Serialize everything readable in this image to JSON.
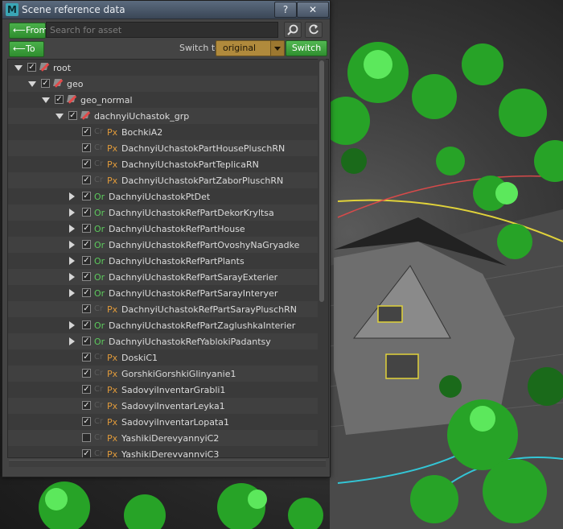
{
  "window": {
    "title": "Scene reference data",
    "app_icon_letter": "M",
    "help_label": "?",
    "close_label": "✕"
  },
  "toolbar": {
    "from_label": "From",
    "to_label": "To",
    "arrow_glyph": "⟵",
    "search_placeholder": "Search for asset",
    "search_value": "",
    "switch_to_label": "Switch to",
    "version_value": "original",
    "switch_button_label": "Switch",
    "icons": {
      "search": "search-icon",
      "refresh": "refresh-icon"
    }
  },
  "tree": {
    "rows": [
      {
        "label": "root",
        "depth": 0,
        "expander": "open",
        "checked": true,
        "badge": "ref"
      },
      {
        "label": "geo",
        "depth": 1,
        "expander": "open",
        "checked": true,
        "badge": "ref"
      },
      {
        "label": "geo_normal",
        "depth": 2,
        "expander": "open",
        "checked": true,
        "badge": "ref"
      },
      {
        "label": "dachnyiUchastok_grp",
        "depth": 3,
        "expander": "open",
        "checked": true,
        "badge": "ref"
      },
      {
        "label": "BochkiA2",
        "depth": 4,
        "expander": "none",
        "checked": true,
        "badge": "Px",
        "ghost": "Cr"
      },
      {
        "label": "DachnyiUchastokPartHousePluschRN",
        "depth": 4,
        "expander": "none",
        "checked": true,
        "badge": "Px",
        "ghost": "Cr"
      },
      {
        "label": "DachnyiUchastokPartTeplicaRN",
        "depth": 4,
        "expander": "none",
        "checked": true,
        "badge": "Px",
        "ghost": "Cr"
      },
      {
        "label": "DachnyiUchastokPartZaborPluschRN",
        "depth": 4,
        "expander": "none",
        "checked": true,
        "badge": "Px",
        "ghost": "Cr"
      },
      {
        "label": "DachnyiUchastokPtDet",
        "depth": 4,
        "expander": "closed",
        "checked": true,
        "badge": "Or"
      },
      {
        "label": "DachnyiUchastokRefPartDekorKryltsa",
        "depth": 4,
        "expander": "closed",
        "checked": true,
        "badge": "Or"
      },
      {
        "label": "DachnyiUchastokRefPartHouse",
        "depth": 4,
        "expander": "closed",
        "checked": true,
        "badge": "Or"
      },
      {
        "label": "DachnyiUchastokRefPartOvoshyNaGryadke",
        "depth": 4,
        "expander": "closed",
        "checked": true,
        "badge": "Or"
      },
      {
        "label": "DachnyiUchastokRefPartPlants",
        "depth": 4,
        "expander": "closed",
        "checked": true,
        "badge": "Or"
      },
      {
        "label": "DachnyiUchastokRefPartSarayExterier",
        "depth": 4,
        "expander": "closed",
        "checked": true,
        "badge": "Or"
      },
      {
        "label": "DachnyiUchastokRefPartSarayInteryer",
        "depth": 4,
        "expander": "closed",
        "checked": true,
        "badge": "Or"
      },
      {
        "label": "DachnyiUchastokRefPartSarayPluschRN",
        "depth": 4,
        "expander": "none",
        "checked": true,
        "badge": "Px",
        "ghost": "Cr"
      },
      {
        "label": "DachnyiUchastokRefPartZaglushkaInterier",
        "depth": 4,
        "expander": "closed",
        "checked": true,
        "badge": "Or"
      },
      {
        "label": "DachnyiUchastokRefYablokiPadantsy",
        "depth": 4,
        "expander": "closed",
        "checked": true,
        "badge": "Or"
      },
      {
        "label": "DoskiC1",
        "depth": 4,
        "expander": "none",
        "checked": true,
        "badge": "Px",
        "ghost": "Cr"
      },
      {
        "label": "GorshkiGorshkiGlinyanie1",
        "depth": 4,
        "expander": "none",
        "checked": true,
        "badge": "Px",
        "ghost": "Cr"
      },
      {
        "label": "SadovyiInventarGrabli1",
        "depth": 4,
        "expander": "none",
        "checked": true,
        "badge": "Px",
        "ghost": "Cr"
      },
      {
        "label": "SadovyiInventarLeyka1",
        "depth": 4,
        "expander": "none",
        "checked": true,
        "badge": "Px",
        "ghost": "Cr"
      },
      {
        "label": "SadovyiInventarLopata1",
        "depth": 4,
        "expander": "none",
        "checked": true,
        "badge": "Px",
        "ghost": "Cr"
      },
      {
        "label": "YashikiDerevyannyiC2",
        "depth": 4,
        "expander": "none",
        "checked": false,
        "badge": "Px",
        "ghost": "Cr"
      },
      {
        "label": "YashikiDerevyannyiC3",
        "depth": 4,
        "expander": "none",
        "checked": true,
        "badge": "Px",
        "ghost": "Cr"
      }
    ]
  },
  "colors": {
    "accent_green": "#3fa63f",
    "version_gold": "#b08a3c",
    "badge_or": "#5cc95c",
    "badge_px": "#e09a3a",
    "ref_icon_red": "#e24a4a"
  }
}
